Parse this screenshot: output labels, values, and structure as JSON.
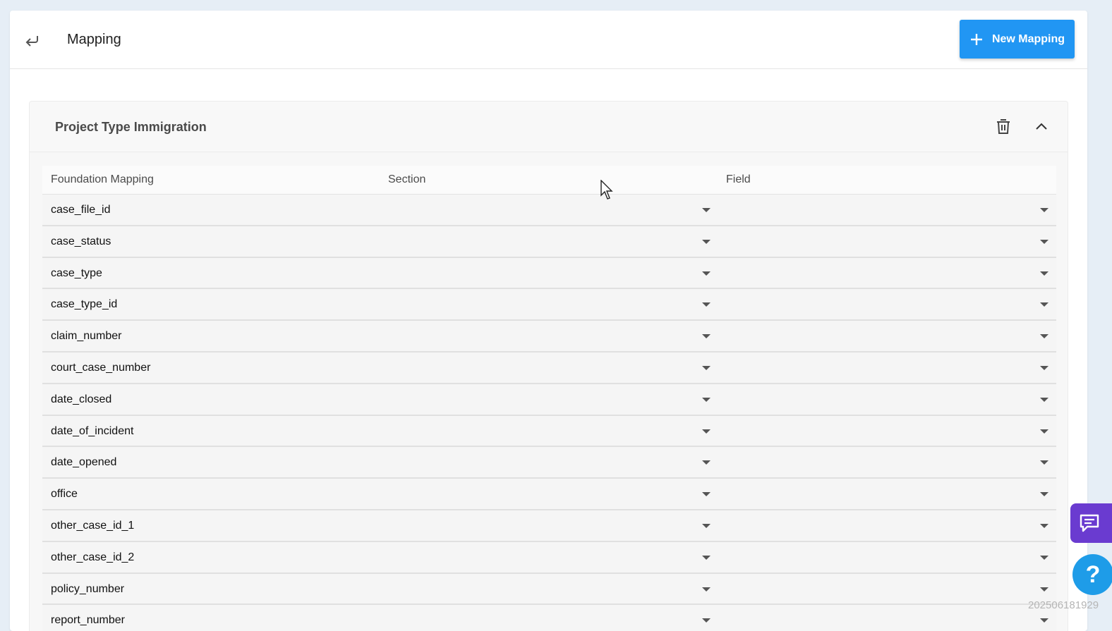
{
  "header": {
    "title": "Mapping",
    "new_button_label": "New Mapping"
  },
  "section": {
    "title": "Project Type Immigration"
  },
  "table": {
    "columns": [
      "Foundation Mapping",
      "Section",
      "Field"
    ],
    "rows": [
      "case_file_id",
      "case_status",
      "case_type",
      "case_type_id",
      "claim_number",
      "court_case_number",
      "date_closed",
      "date_of_incident",
      "date_opened",
      "office",
      "other_case_id_1",
      "other_case_id_2",
      "policy_number",
      "report_number"
    ]
  },
  "icons": {
    "back": "back-arrow-icon",
    "add": "plus-icon",
    "delete": "trash-icon",
    "collapse": "chevron-up-icon",
    "chat": "chat-icon",
    "help": "question-icon"
  },
  "help_label": "?",
  "watermark": "202506181929",
  "colors": {
    "primary": "#2196f3",
    "chat": "#6a3bd0",
    "help": "#1e9ce8"
  }
}
